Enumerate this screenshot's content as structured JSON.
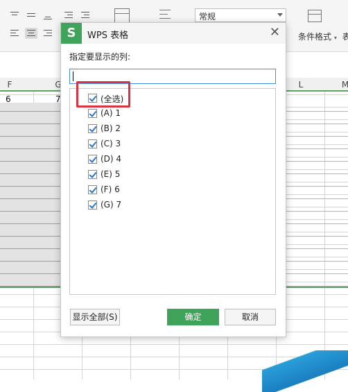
{
  "ribbon": {
    "number_format": "常规",
    "conditional_format_label": "条件格式",
    "more_label": "表"
  },
  "sheet": {
    "columns": [
      "F",
      "G",
      "L",
      "M"
    ],
    "cell_f": "6",
    "cell_g": "7"
  },
  "dialog": {
    "logo": "S",
    "title": "WPS 表格",
    "close": "✕",
    "prompt": "指定要显示的列:",
    "input_value": "",
    "items": [
      {
        "label": "(全选)",
        "checked": true
      },
      {
        "label": "(A) 1",
        "checked": true
      },
      {
        "label": "(B) 2",
        "checked": true
      },
      {
        "label": "(C) 3",
        "checked": true
      },
      {
        "label": "(D) 4",
        "checked": true
      },
      {
        "label": "(E) 5",
        "checked": true
      },
      {
        "label": "(F) 6",
        "checked": true
      },
      {
        "label": "(G) 7",
        "checked": true
      }
    ],
    "show_all_button": "显示全部(S)",
    "ok_button": "确定",
    "cancel_button": "取消"
  },
  "colors": {
    "accent_green": "#3fa35a",
    "highlight_red": "#d9333f",
    "checkbox_blue": "#4d97dd"
  }
}
